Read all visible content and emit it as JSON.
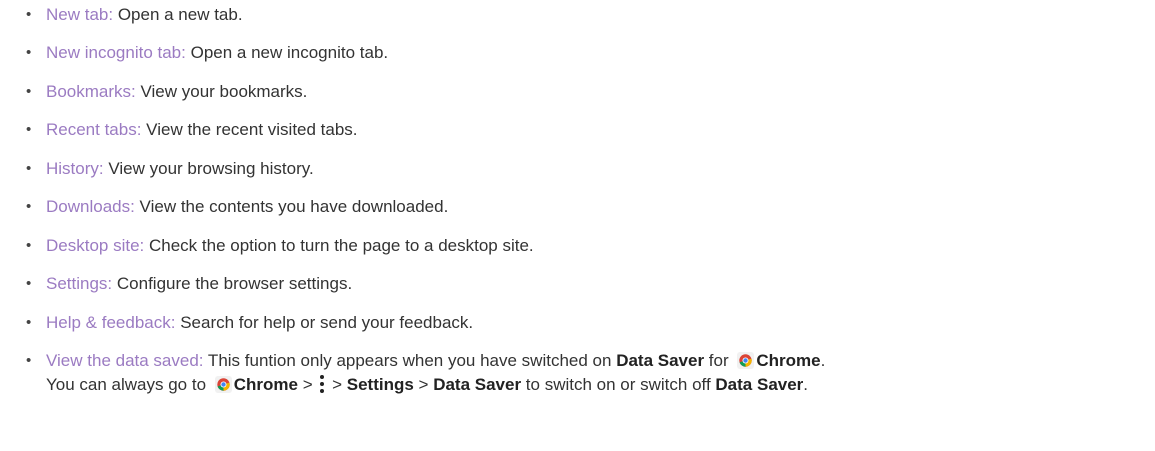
{
  "items": [
    {
      "term": "New tab:",
      "desc": " Open a new tab."
    },
    {
      "term": "New incognito tab:",
      "desc": " Open a new incognito tab."
    },
    {
      "term": "Bookmarks:",
      "desc": " View your bookmarks."
    },
    {
      "term": "Recent tabs:",
      "desc": " View the recent visited tabs."
    },
    {
      "term": "History:",
      "desc": " View your browsing history."
    },
    {
      "term": "Downloads:",
      "desc": " View the contents you have downloaded."
    },
    {
      "term": "Desktop site:",
      "desc": " Check the option to turn the page to a desktop site."
    },
    {
      "term": "Settings:",
      "desc": " Configure the browser settings."
    },
    {
      "term": "Help & feedback:",
      "desc": " Search for help or send your feedback."
    }
  ],
  "last_item": {
    "term": "View the data saved:",
    "line1_text": " This funtion only appears when you have switched on ",
    "line1_bold1": "Data Saver",
    "line1_mid": " for ",
    "line1_bold2": "Chrome",
    "line1_end": ".",
    "line2_start": "You can always go to ",
    "line2_bold_chrome": "Chrome",
    "line2_sep1": " > ",
    "line2_sep2": " > ",
    "line2_bold_settings": "Settings",
    "line2_sep3": " > ",
    "line2_bold_datasaver": "Data Saver",
    "line2_mid": " to switch on or switch off ",
    "line2_bold_datasaver2": "Data Saver",
    "line2_end": "."
  },
  "bullet": "•",
  "colors": {
    "term": "#9b7bc2",
    "text": "#333333"
  },
  "icons": {
    "chrome": "chrome-icon",
    "menu": "more-vert-icon"
  }
}
